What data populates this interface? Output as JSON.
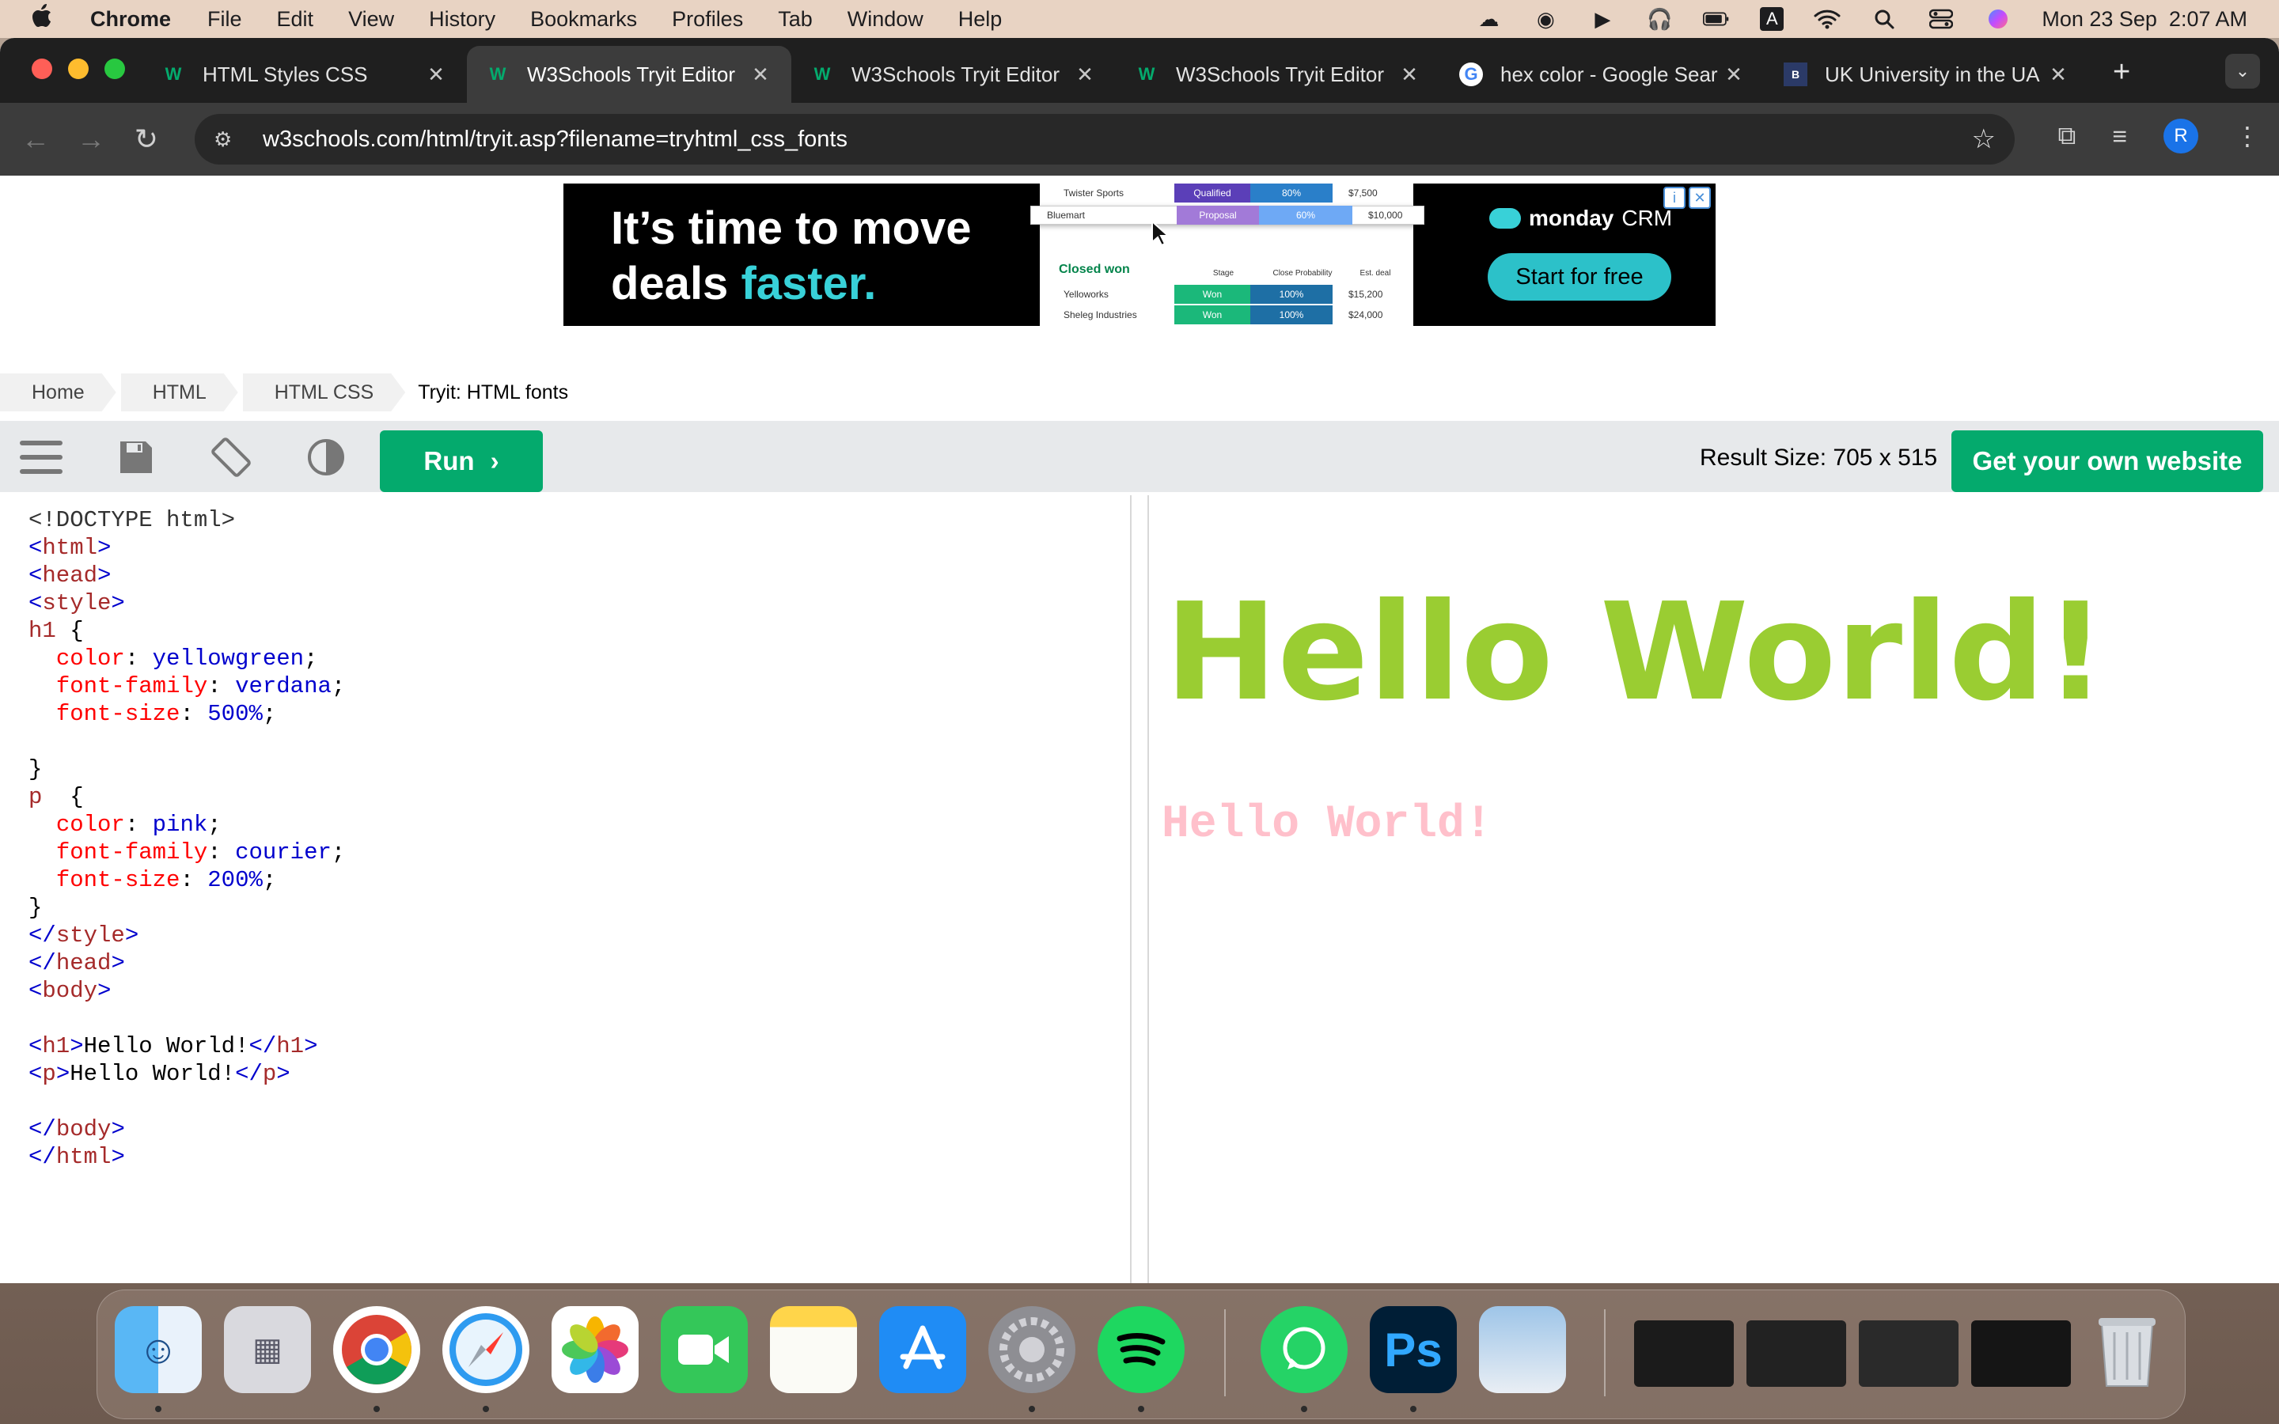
{
  "menubar": {
    "app": "Chrome",
    "items": [
      "File",
      "Edit",
      "View",
      "History",
      "Bookmarks",
      "Profiles",
      "Tab",
      "Window",
      "Help"
    ],
    "datetime": "Mon 23 Sep  2:07 AM",
    "input_source": "A"
  },
  "browser": {
    "tabs": [
      {
        "title": "HTML Styles CSS",
        "favicon": "W"
      },
      {
        "title": "W3Schools Tryit Editor",
        "favicon": "W"
      },
      {
        "title": "W3Schools Tryit Editor",
        "favicon": "W"
      },
      {
        "title": "W3Schools Tryit Editor",
        "favicon": "W"
      },
      {
        "title": "hex color - Google Sear",
        "favicon": "G"
      },
      {
        "title": "UK University in the UA",
        "favicon": "B"
      }
    ],
    "active_tab_index": 1,
    "url": "w3schools.com/html/tryit.asp?filename=tryhtml_css_fonts",
    "profile_initial": "R"
  },
  "ad": {
    "headline_line1": "It’s time to move",
    "headline_line2_a": "deals ",
    "headline_line2_b": "faster.",
    "brand": "monday",
    "brand_suffix": "CRM",
    "cta": "Start for free",
    "table_rows": [
      {
        "name": "Twister Sports",
        "stage": "Qualified",
        "prob": "80%",
        "deal": "$7,500"
      },
      {
        "name": "Bluemart",
        "stage": "Proposal",
        "prob": "60%",
        "deal": "$10,000"
      }
    ],
    "closed_title": "Closed won",
    "closed_headers": [
      "Stage",
      "Close Probability",
      "Est. deal"
    ],
    "closed_rows": [
      {
        "name": "Yelloworks",
        "stage": "Won",
        "prob": "100%",
        "deal": "$15,200"
      },
      {
        "name": "Sheleg Industries",
        "stage": "Won",
        "prob": "100%",
        "deal": "$24,000"
      }
    ]
  },
  "breadcrumb": [
    "Home",
    "HTML",
    "HTML CSS",
    "Tryit: HTML fonts"
  ],
  "editor": {
    "run_label": "Run",
    "result_size": "Result Size: 705 x 515",
    "own_website": "Get your own website",
    "code_lines": [
      "<!DOCTYPE html>",
      "<html>",
      "<head>",
      "<style>",
      "h1 {",
      "  color: yellowgreen;",
      "  font-family: verdana;",
      "  font-size: 500%;",
      "",
      "}",
      "p  {",
      "  color: pink;",
      "  font-family: courier;",
      "  font-size: 200%;",
      "}",
      "</style>",
      "</head>",
      "<body>",
      "",
      "<h1>Hello World!</h1>",
      "<p>Hello World!</p>",
      "",
      "</body>",
      "</html>"
    ]
  },
  "result": {
    "h1_text": "Hello World!",
    "p_text": "Hello World!",
    "h1_color": "yellowgreen",
    "p_color": "pink"
  },
  "dock": {
    "apps": [
      "Finder",
      "Launchpad",
      "Chrome",
      "Safari",
      "Photos",
      "FaceTime",
      "Notes",
      "App Store",
      "System Settings",
      "Spotify",
      "WhatsApp",
      "Photoshop",
      "Preview",
      "Trash"
    ]
  },
  "colors": {
    "w3_green": "#04aa6d",
    "chrome_dark": "#1f1f1f",
    "menubar": "#e8d3c3"
  }
}
